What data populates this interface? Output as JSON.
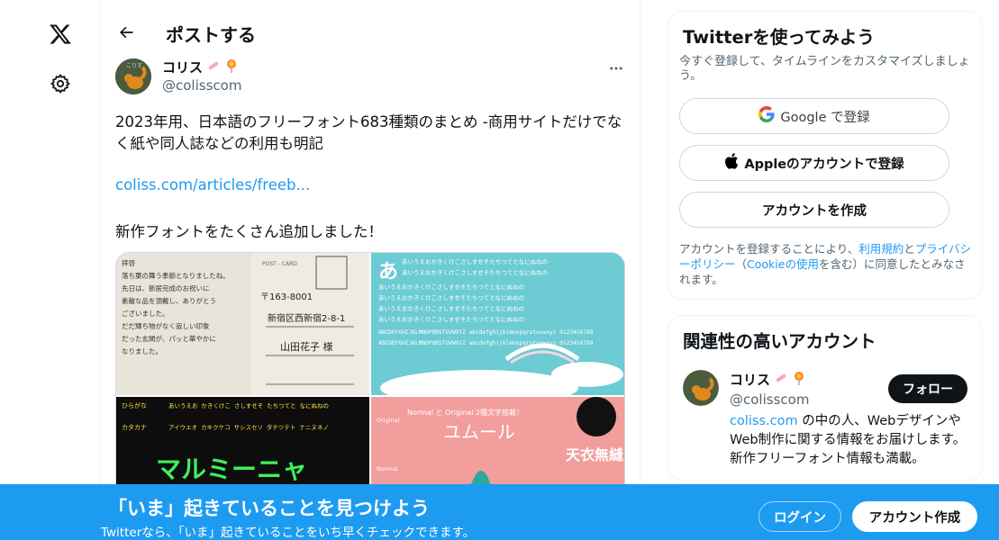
{
  "nav": {
    "icons": [
      "x-logo-icon",
      "gear-icon"
    ]
  },
  "header": {
    "title": "ポストする"
  },
  "post": {
    "author_name": "コリス",
    "author_handle": "@colisscom",
    "text": "2023年用、日本語のフリーフォント683種類のまとめ -商用サイトだけでなく紙や同人誌などの利用も明記",
    "link": "coliss.com/articles/freeb...",
    "text2": "新作フォントをたくさん追加しました！"
  },
  "signup_card": {
    "title": "Twitterを使ってみよう",
    "subtitle": "今すぐ登録して、タイムラインをカスタマイズしましょう。",
    "google_label": "Google で登録",
    "apple_label": "Appleのアカウントで登録",
    "create_label": "アカウントを作成",
    "terms_prefix": "アカウントを登録することにより、",
    "terms_link": "利用規約",
    "terms_and": "と",
    "privacy_link": "プライバシーポリシー",
    "cookie_open": "（",
    "cookie_link": "Cookieの使用",
    "terms_suffix": "を含む）に同意したとみなされます。"
  },
  "related": {
    "title": "関連性の高いアカウント",
    "name": "コリス",
    "handle": "@colisscom",
    "follow_label": "フォロー",
    "bio_link": "coliss.com",
    "bio_text": " の中の人、Webデザインや Web制作に関する情報をお届けします。新作フリーフォント情報も満載。"
  },
  "bottombar": {
    "title": "「いま」起きていることを見つけよう",
    "subtitle": "Twitterなら、「いま」起きていることをいち早くチェックできます。",
    "login_label": "ログイン",
    "signup_label": "アカウント作成"
  },
  "media": {
    "postcard_lines": [
      "拝啓",
      "落ち葉の舞う季節となりましたね。",
      "先日は、新居完成のお祝いに",
      "素敵な品を頂戴し、ありがとう",
      "ございました。",
      "だだ輝ち物がなく寂しい印象",
      "だった玄関が、パッと華やかに",
      "なりました。"
    ],
    "postcard_header": "POST - CARD",
    "postcard_zip": "〒163-8001",
    "postcard_address": "新宿区西新宿2-8-1",
    "postcard_name": "山田花子 様",
    "kana_sample": "あいうえおかきくけこさしすせそたちつてとなにぬねの",
    "latin_sample": "ABCDEFGHIJKLMNOPQRSTUVWXYZ abcdefghijklmnopqrstuvwxyz 0123456789",
    "kana_big": "あ",
    "dot_font_title": "マルミーニャ",
    "dot_labels": [
      "ひらがな",
      "カタカナ"
    ],
    "dot_rows": [
      "あいうえお かきくけこ さしすせそ たちつてと なにぬねの",
      "アイウエオ カキクケコ サシスセソ タチツテト ナニヌネノ"
    ],
    "tile4_headline": "Normal と Original 2種文字搭載！",
    "tile4_title": "ユムール",
    "tile4_big": "天衣無縫",
    "tile4_labels": [
      "Original",
      "Normal"
    ]
  }
}
